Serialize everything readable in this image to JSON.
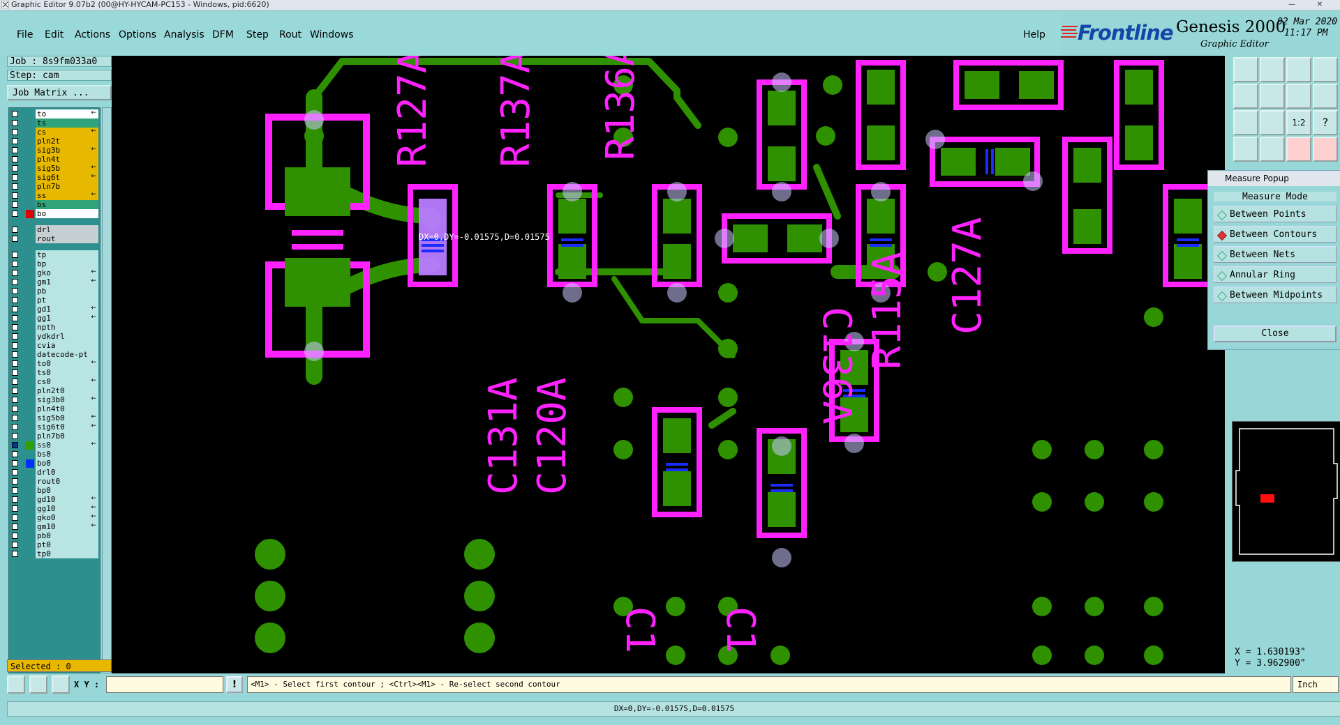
{
  "window": {
    "title": "Graphic Editor 9.07b2 (00@HY-HYCAM-PC153 - Windows, pid:6620)"
  },
  "menu": {
    "items": [
      "File",
      "Edit",
      "Actions",
      "Options",
      "Analysis",
      "DFM",
      "Step",
      "Rout",
      "Windows"
    ],
    "help": "Help"
  },
  "logo": {
    "brand": "Frontline",
    "product": "Genesis 2000",
    "subtitle": "Graphic Editor",
    "date": "02 Mar 2020",
    "time": "11:17 PM"
  },
  "info": {
    "job": "Job : 8s9fm033a0",
    "step": "Step: cam",
    "job_matrix": "Job Matrix ..."
  },
  "layers": [
    {
      "name": "to",
      "style": "wh",
      "flag": "←"
    },
    {
      "name": "ts",
      "style": "grn",
      "flag": ""
    },
    {
      "name": "cs",
      "style": "hl",
      "flag": "←"
    },
    {
      "name": "pln2t",
      "style": "hl",
      "flag": ""
    },
    {
      "name": "sig3b",
      "style": "hl",
      "flag": "←"
    },
    {
      "name": "pln4t",
      "style": "hl",
      "flag": ""
    },
    {
      "name": "sig5b",
      "style": "hl",
      "flag": "←"
    },
    {
      "name": "sig6t",
      "style": "hl",
      "flag": "←"
    },
    {
      "name": "pln7b",
      "style": "hl",
      "flag": ""
    },
    {
      "name": "ss",
      "style": "hl",
      "flag": "←"
    },
    {
      "name": "bs",
      "style": "grn",
      "flag": ""
    },
    {
      "name": "bo",
      "style": "wh",
      "flag": "",
      "swatch": "#e00000"
    },
    {
      "name": "drl",
      "style": "gry",
      "flag": "",
      "gap": true
    },
    {
      "name": "rout",
      "style": "gry",
      "flag": ""
    },
    {
      "name": "tp",
      "style": "",
      "flag": "",
      "gap": true
    },
    {
      "name": "bp",
      "style": "",
      "flag": ""
    },
    {
      "name": "gko",
      "style": "",
      "flag": "←"
    },
    {
      "name": "gm1",
      "style": "",
      "flag": "←"
    },
    {
      "name": "pb",
      "style": "",
      "flag": ""
    },
    {
      "name": "pt",
      "style": "",
      "flag": ""
    },
    {
      "name": "gd1",
      "style": "",
      "flag": "←"
    },
    {
      "name": "gg1",
      "style": "",
      "flag": "←"
    },
    {
      "name": "npth",
      "style": "",
      "flag": ""
    },
    {
      "name": "ydkdrl",
      "style": "",
      "flag": ""
    },
    {
      "name": "cvia",
      "style": "",
      "flag": ""
    },
    {
      "name": "datecode-pt",
      "style": "",
      "flag": ""
    },
    {
      "name": "to0",
      "style": "",
      "flag": "←"
    },
    {
      "name": "ts0",
      "style": "",
      "flag": ""
    },
    {
      "name": "cs0",
      "style": "",
      "flag": "←"
    },
    {
      "name": "pln2t0",
      "style": "",
      "flag": ""
    },
    {
      "name": "sig3b0",
      "style": "",
      "flag": "←"
    },
    {
      "name": "pln4t0",
      "style": "",
      "flag": ""
    },
    {
      "name": "sig5b0",
      "style": "",
      "flag": "←"
    },
    {
      "name": "sig6t0",
      "style": "",
      "flag": "←"
    },
    {
      "name": "pln7b0",
      "style": "",
      "flag": ""
    },
    {
      "name": "ss0",
      "style": "",
      "flag": "←",
      "swatch": "#2fa000",
      "chk": "#003a8c"
    },
    {
      "name": "bs0",
      "style": "",
      "flag": ""
    },
    {
      "name": "bo0",
      "style": "",
      "flag": "",
      "swatch": "#0030ff"
    },
    {
      "name": "drl0",
      "style": "",
      "flag": ""
    },
    {
      "name": "rout0",
      "style": "",
      "flag": ""
    },
    {
      "name": "bp0",
      "style": "",
      "flag": ""
    },
    {
      "name": "gd10",
      "style": "",
      "flag": "←"
    },
    {
      "name": "gg10",
      "style": "",
      "flag": "←"
    },
    {
      "name": "gko0",
      "style": "",
      "flag": "←"
    },
    {
      "name": "gm10",
      "style": "",
      "flag": "←"
    },
    {
      "name": "pb0",
      "style": "",
      "flag": ""
    },
    {
      "name": "pt0",
      "style": "",
      "flag": ""
    },
    {
      "name": "tp0",
      "style": "",
      "flag": ""
    }
  ],
  "selected": "Selected : 0",
  "measure_popup": {
    "title": "Measure Popup",
    "header": "Measure Mode",
    "options": [
      "Between Points",
      "Between Contours",
      "Between Nets",
      "Annular Ring",
      "Between Midpoints"
    ],
    "active": 1,
    "close": "Close"
  },
  "coords": {
    "x": "X = 1.630193\"",
    "y": "Y = 3.962900\""
  },
  "status": {
    "xy_label": "X Y :",
    "xy_value": "",
    "prompt": "<M1> - Select first contour ; <Ctrl><M1> - Re-select second contour",
    "unit": "Inch",
    "measurement": "DX=0,DY=-0.01575,D=0.01575"
  },
  "canvas": {
    "measure_label": "DX=0,DY=-0.01575,D=0.01575",
    "refdes": [
      "R127A",
      "R137A",
      "R136A",
      "C136A",
      "R115A",
      "C127A",
      "C131A",
      "C120A",
      "C1",
      "C1"
    ]
  },
  "colors": {
    "pad": "#2f9100",
    "outline": "#ff22ff",
    "highlight": "#b97bff",
    "pin1": "#1a2cff"
  }
}
